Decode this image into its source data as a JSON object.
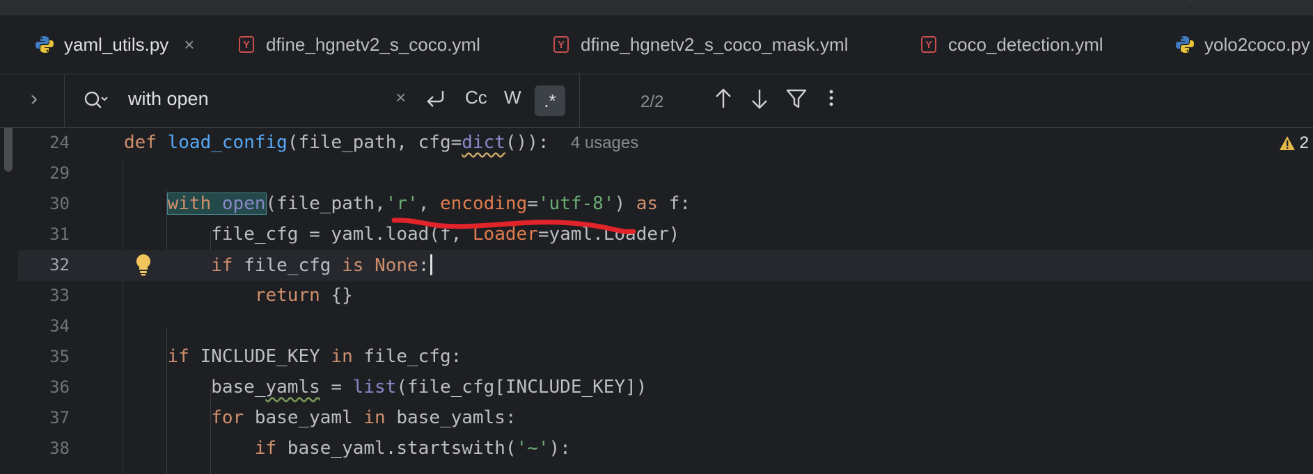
{
  "topbar": {
    "edge_glyph": "'"
  },
  "tabs": [
    {
      "label": "yaml_utils.py",
      "icon": "python-icon",
      "active": true,
      "close": "×"
    },
    {
      "label": "dfine_hgnetv2_s_coco.yml",
      "icon": "yaml-icon",
      "icon_letter": "Y"
    },
    {
      "label": "dfine_hgnetv2_s_coco_mask.yml",
      "icon": "yaml-icon",
      "icon_letter": "Y"
    },
    {
      "label": "coco_detection.yml",
      "icon": "yaml-icon",
      "icon_letter": "Y"
    },
    {
      "label": "yolo2coco.py",
      "icon": "python-icon"
    }
  ],
  "find": {
    "query": "with open",
    "clear": "×",
    "match_case": "Cc",
    "words": "W",
    "regex": ".*",
    "count": "2/2"
  },
  "editor": {
    "lines": [
      {
        "n": "24"
      },
      {
        "n": "29"
      },
      {
        "n": "30"
      },
      {
        "n": "31"
      },
      {
        "n": "32"
      },
      {
        "n": "33"
      },
      {
        "n": "34"
      },
      {
        "n": "35"
      },
      {
        "n": "36"
      },
      {
        "n": "37"
      },
      {
        "n": "38"
      }
    ],
    "usages_hint": "4 usages",
    "warnings": "2"
  },
  "colors": {
    "accent": "#3574f0",
    "keyword": "#cf8e6d",
    "function": "#56a8f5",
    "string": "#6aab73",
    "annotation_stroke": "#e0242a"
  }
}
